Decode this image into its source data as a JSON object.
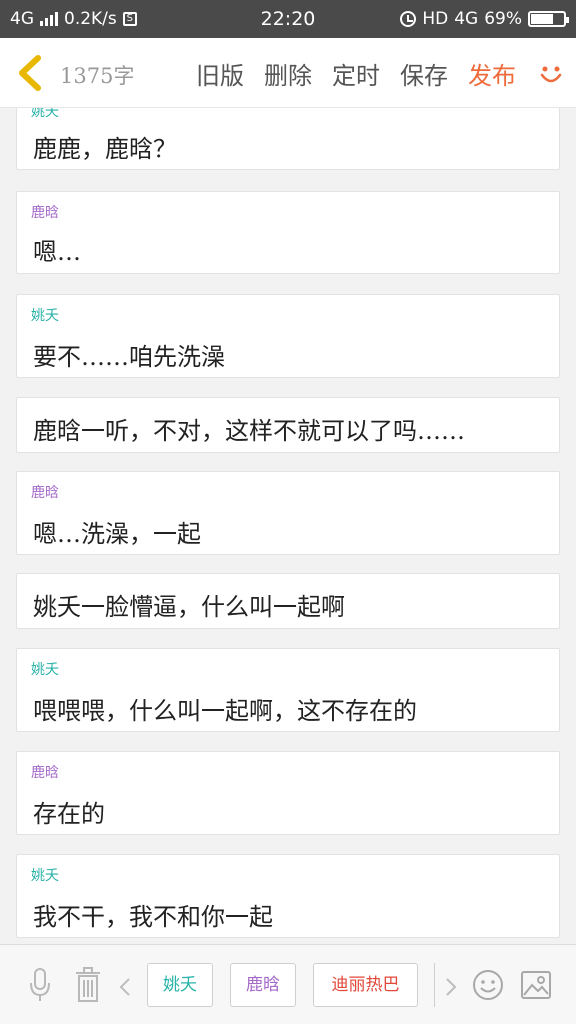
{
  "status_bar": {
    "network": "4G",
    "speed": "0.2K/s",
    "time": "22:20",
    "hd": "HD",
    "network_right": "4G",
    "battery_percent": "69%",
    "battery_level": 0.69
  },
  "header": {
    "word_count": "1375字",
    "actions": {
      "old_version": "旧版",
      "delete": "删除",
      "schedule": "定时",
      "save": "保存",
      "publish": "发布"
    },
    "colors": {
      "publish": "#ee6a3a"
    }
  },
  "messages": [
    {
      "speaker": "姚夭",
      "text": "鹿鹿，鹿晗？"
    },
    {
      "speaker": "鹿晗",
      "text": "嗯…"
    },
    {
      "speaker": "姚夭",
      "text": "要不……咱先洗澡"
    },
    {
      "speaker": "",
      "text": "鹿晗一听，不对，这样不就可以了吗……"
    },
    {
      "speaker": "鹿晗",
      "text": "嗯…洗澡，一起"
    },
    {
      "speaker": "",
      "text": "姚夭一脸懵逼，什么叫一起啊"
    },
    {
      "speaker": "姚夭",
      "text": "喂喂喂，什么叫一起啊，这不存在的"
    },
    {
      "speaker": "鹿晗",
      "text": "存在的"
    },
    {
      "speaker": "姚夭",
      "text": "我不干，我不和你一起"
    }
  ],
  "toolbar": {
    "chips": [
      "姚夭",
      "鹿晗",
      "迪丽热巴"
    ],
    "colors": {
      "yao": "#2ab3a8",
      "lu": "#a56ac9",
      "dili": "#e0483a"
    }
  }
}
